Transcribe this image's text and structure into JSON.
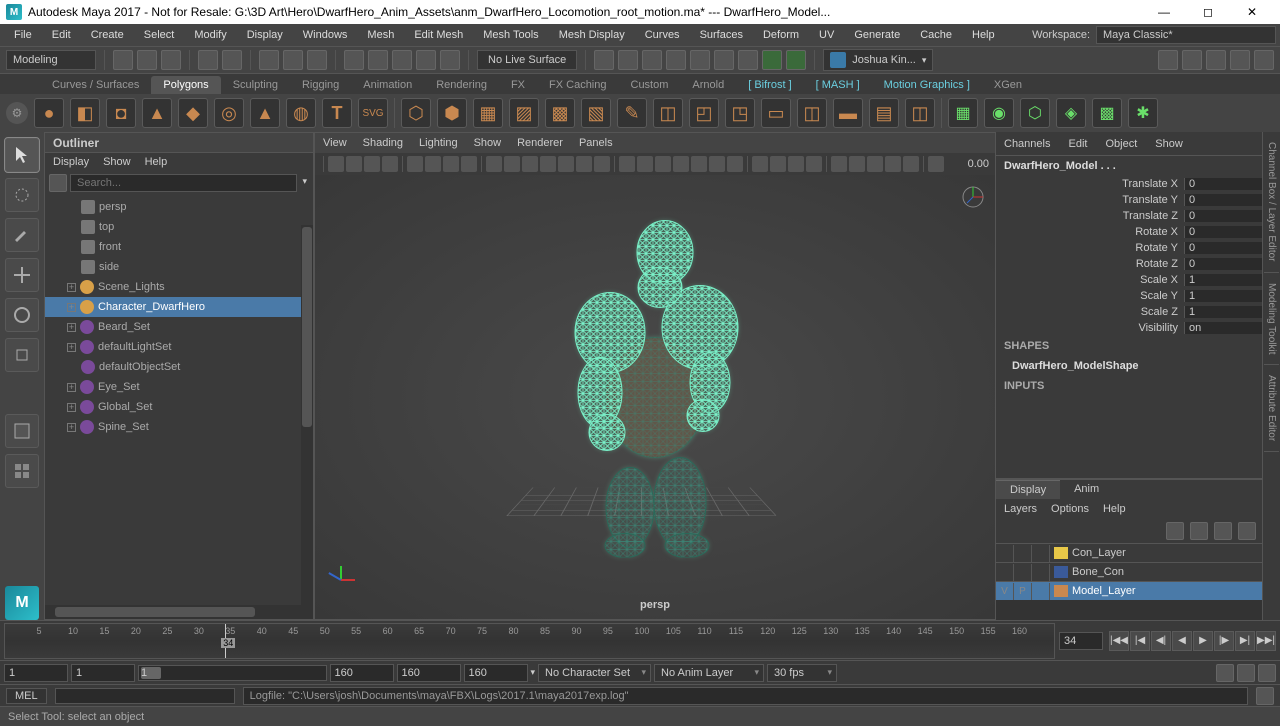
{
  "title": "Autodesk Maya 2017 - Not for Resale: G:\\3D Art\\Hero\\DwarfHero_Anim_Assets\\anm_DwarfHero_Locomotion_root_motion.ma*   ---   DwarfHero_Model...",
  "menus": [
    "File",
    "Edit",
    "Create",
    "Select",
    "Modify",
    "Display",
    "Windows",
    "Mesh",
    "Edit Mesh",
    "Mesh Tools",
    "Mesh Display",
    "Curves",
    "Surfaces",
    "Deform",
    "UV",
    "Generate",
    "Cache",
    "Help"
  ],
  "workspace_label": "Workspace:",
  "workspace_value": "Maya Classic*",
  "mode_dropdown": "Modeling",
  "live_surface": "No Live Surface",
  "user": "Joshua Kin...",
  "shelf_tabs": [
    "Curves / Surfaces",
    "Polygons",
    "Sculpting",
    "Rigging",
    "Animation",
    "Rendering",
    "FX",
    "FX Caching",
    "Custom",
    "Arnold",
    "Bifrost",
    "MASH",
    "Motion Graphics",
    "XGen"
  ],
  "shelf_active": 1,
  "outliner": {
    "title": "Outliner",
    "menus": [
      "Display",
      "Show",
      "Help"
    ],
    "search_placeholder": "Search...",
    "items": [
      {
        "label": "persp",
        "type": "cam",
        "indent": 1
      },
      {
        "label": "top",
        "type": "cam",
        "indent": 1
      },
      {
        "label": "front",
        "type": "cam",
        "indent": 1
      },
      {
        "label": "side",
        "type": "cam",
        "indent": 1
      },
      {
        "label": "Scene_Lights",
        "type": "sun",
        "indent": 1,
        "exp": "+"
      },
      {
        "label": "Character_DwarfHero",
        "type": "sun",
        "indent": 1,
        "exp": "+",
        "sel": true
      },
      {
        "label": "Beard_Set",
        "type": "set",
        "indent": 1,
        "exp": "+"
      },
      {
        "label": "defaultLightSet",
        "type": "set",
        "indent": 1,
        "exp": "+"
      },
      {
        "label": "defaultObjectSet",
        "type": "set",
        "indent": 1
      },
      {
        "label": "Eye_Set",
        "type": "set",
        "indent": 1,
        "exp": "+"
      },
      {
        "label": "Global_Set",
        "type": "set",
        "indent": 1,
        "exp": "+"
      },
      {
        "label": "Spine_Set",
        "type": "set",
        "indent": 1,
        "exp": "+"
      }
    ]
  },
  "viewport": {
    "menus": [
      "View",
      "Shading",
      "Lighting",
      "Show",
      "Renderer",
      "Panels"
    ],
    "camera": "persp",
    "frame": "0.00"
  },
  "channel": {
    "menus": [
      "Channels",
      "Edit",
      "Object",
      "Show"
    ],
    "node": "DwarfHero_Model . . .",
    "attrs": [
      {
        "n": "Translate X",
        "v": "0"
      },
      {
        "n": "Translate Y",
        "v": "0"
      },
      {
        "n": "Translate Z",
        "v": "0"
      },
      {
        "n": "Rotate X",
        "v": "0"
      },
      {
        "n": "Rotate Y",
        "v": "0"
      },
      {
        "n": "Rotate Z",
        "v": "0"
      },
      {
        "n": "Scale X",
        "v": "1"
      },
      {
        "n": "Scale Y",
        "v": "1"
      },
      {
        "n": "Scale Z",
        "v": "1"
      },
      {
        "n": "Visibility",
        "v": "on"
      }
    ],
    "shapes_label": "SHAPES",
    "shape_node": "DwarfHero_ModelShape",
    "inputs_label": "INPUTS",
    "layer_tabs": [
      "Display",
      "Anim"
    ],
    "layer_menu": [
      "Layers",
      "Options",
      "Help"
    ],
    "layers": [
      {
        "name": "Con_Layer",
        "color": "#e8c848",
        "v": "",
        "p": ""
      },
      {
        "name": "Bone_Con",
        "color": "#3a5a9a",
        "v": "",
        "p": ""
      },
      {
        "name": "Model_Layer",
        "color": "#c88850",
        "v": "V",
        "p": "P",
        "sel": true
      }
    ]
  },
  "side_tabs": [
    "Channel Box / Layer Editor",
    "Modeling Toolkit",
    "Attribute Editor"
  ],
  "timeline": {
    "current": "34",
    "ticks": [
      "5",
      "10",
      "15",
      "20",
      "25",
      "30",
      "35",
      "40",
      "45",
      "50",
      "55",
      "60",
      "65",
      "70",
      "75",
      "80",
      "85",
      "90",
      "95",
      "100",
      "105",
      "110",
      "115",
      "120",
      "125",
      "130",
      "135",
      "140",
      "145",
      "150",
      "155",
      "160"
    ],
    "cur_ind": "34"
  },
  "range": {
    "start_out": "1",
    "start_in": "1",
    "thumb": "1",
    "end_in": "160",
    "end_out": "160",
    "end_out2": "160",
    "charset": "No Character Set",
    "animlayer": "No Anim Layer",
    "fps": "30 fps"
  },
  "mel": "MEL",
  "log": "Logfile: \"C:\\Users\\josh\\Documents\\maya\\FBX\\Logs\\2017.1\\maya2017exp.log\"",
  "status": "Select Tool: select an object"
}
